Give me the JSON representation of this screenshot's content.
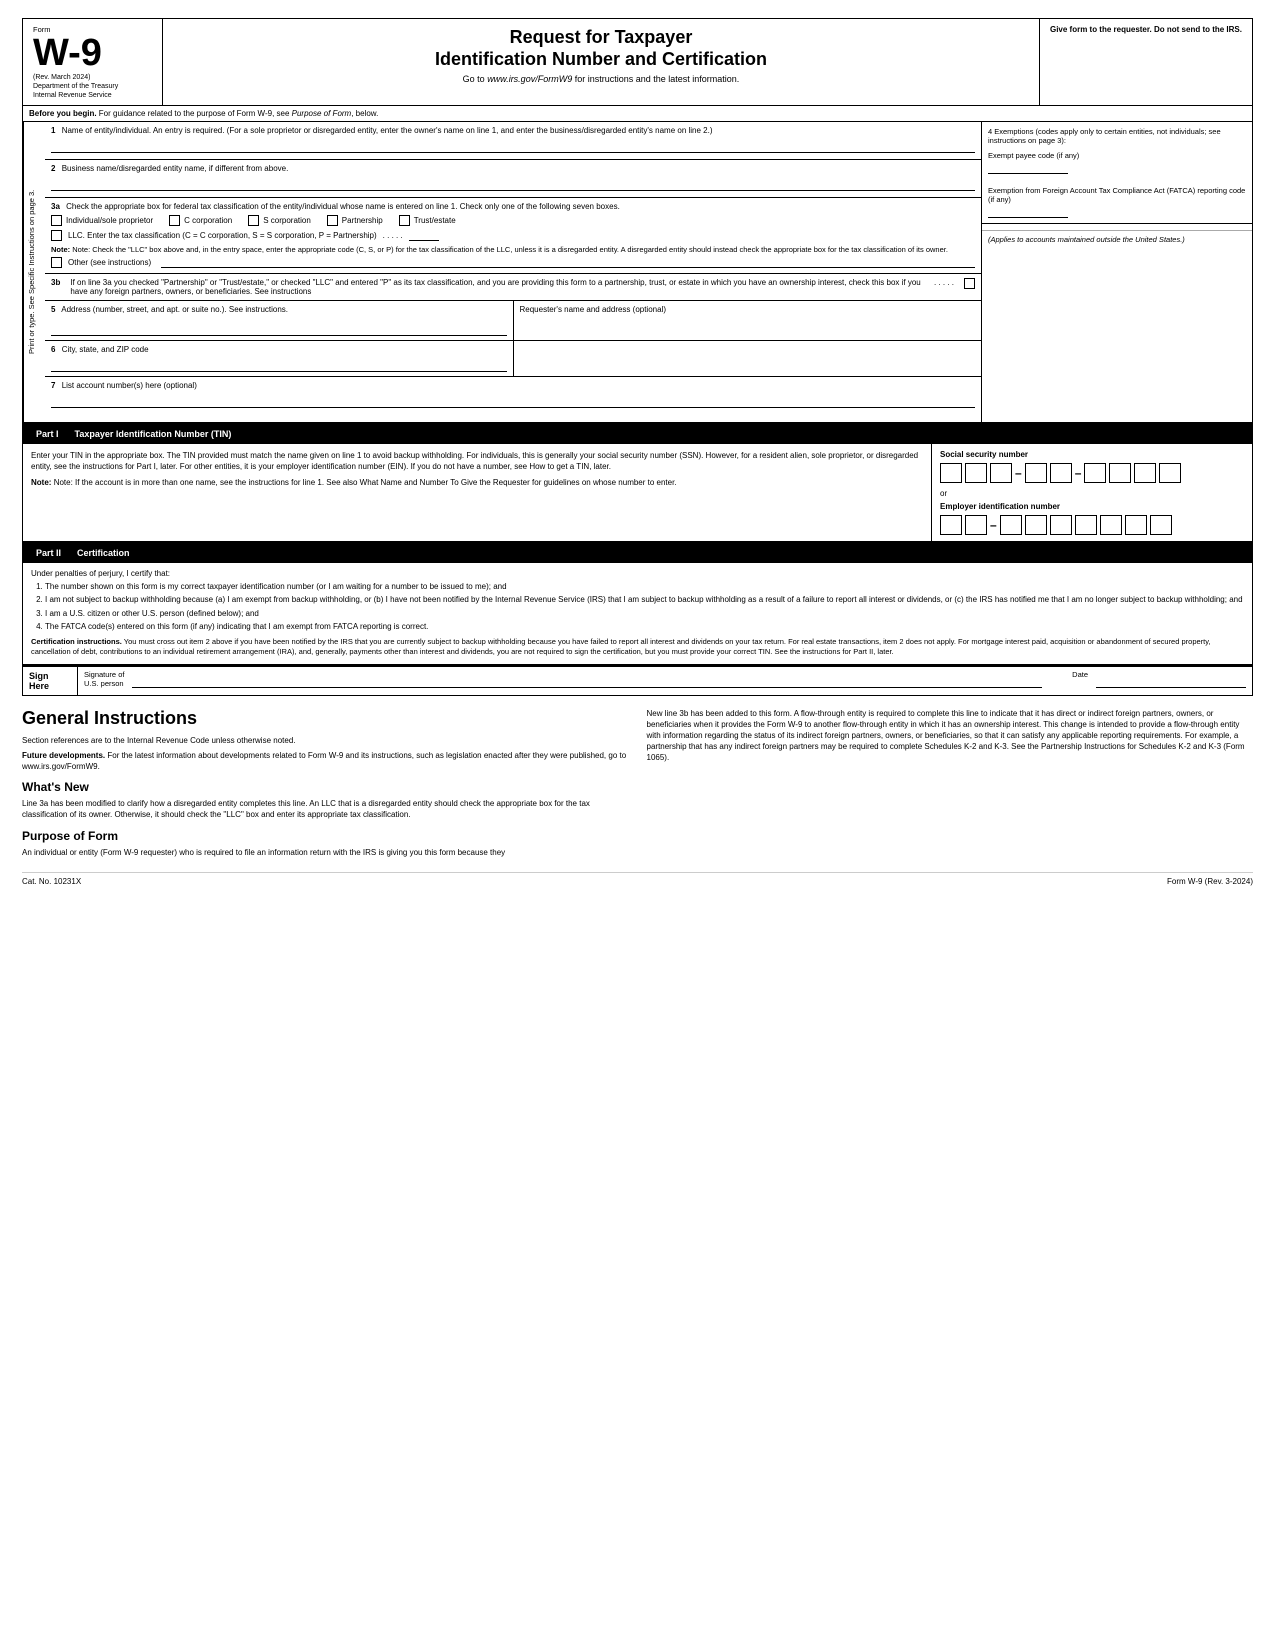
{
  "header": {
    "form_label": "Form",
    "form_number": "W-9",
    "rev_date": "(Rev. March 2024)",
    "dept": "Department of the Treasury",
    "irs": "Internal Revenue Service",
    "title_line1": "Request for Taxpayer",
    "title_line2": "Identification Number and Certification",
    "subtitle": "Go to www.irs.gov/FormW9 for instructions and the latest information.",
    "give_form": "Give form to the requester. Do not send to the IRS."
  },
  "before_begin": {
    "text": "Before you begin. For guidance related to the purpose of Form W-9, see Purpose of Form, below."
  },
  "fields": {
    "field1_label": "1",
    "field1_text": "Name of entity/individual. An entry is required. (For a sole proprietor or disregarded entity, enter the owner's name on line 1, and enter the business/disregarded entity's name on line 2.)",
    "field2_label": "2",
    "field2_text": "Business name/disregarded entity name, if different from above.",
    "field3a_label": "3a",
    "field3a_text": "Check the appropriate box for federal tax classification of the entity/individual whose name is entered on line 1. Check only one of the following seven boxes.",
    "checkboxes": [
      "Individual/sole proprietor",
      "C corporation",
      "S corporation",
      "Partnership",
      "Trust/estate"
    ],
    "llc_text": "LLC. Enter the tax classification (C = C corporation, S = S corporation, P = Partnership)",
    "note_3a": "Note: Check the \"LLC\" box above and, in the entry space, enter the appropriate code (C, S, or P) for the tax classification of the LLC, unless it is a disregarded entity. A disregarded entity should instead check the appropriate box for the tax classification of its owner.",
    "other_text": "Other (see instructions)",
    "field3b_label": "3b",
    "field3b_text": "If on line 3a you checked \"Partnership\" or \"Trust/estate,\" or checked \"LLC\" and entered \"P\" as its tax classification, and you are providing this form to a partnership, trust, or estate in which you have an ownership interest, check this box if you have any foreign partners, owners, or beneficiaries. See instructions",
    "field5_label": "5",
    "field5_text": "Address (number, street, and apt. or suite no.). See instructions.",
    "field5_right": "Requester's name and address (optional)",
    "field6_label": "6",
    "field6_text": "City, state, and ZIP code",
    "field7_label": "7",
    "field7_text": "List account number(s) here (optional)"
  },
  "exemptions": {
    "title": "4 Exemptions (codes apply only to certain entities, not individuals; see instructions on page 3):",
    "exempt_payee": "Exempt payee code (if any)",
    "fatca_title": "Exemption from Foreign Account Tax Compliance Act (FATCA) reporting code (if any)",
    "applies_note": "(Applies to accounts maintained outside the United States.)"
  },
  "part1": {
    "label": "Part I",
    "title": "Taxpayer Identification Number (TIN)",
    "intro": "Enter your TIN in the appropriate box. The TIN provided must match the name given on line 1 to avoid backup withholding. For individuals, this is generally your social security number (SSN). However, for a resident alien, sole proprietor, or disregarded entity, see the instructions for Part I, later. For other entities, it is your employer identification number (EIN). If you do not have a number, see How to get a TIN, later.",
    "note": "Note: If the account is in more than one name, see the instructions for line 1. See also What Name and Number To Give the Requester for guidelines on whose number to enter.",
    "ssn_label": "Social security number",
    "or_text": "or",
    "ein_label": "Employer identification number"
  },
  "part2": {
    "label": "Part II",
    "title": "Certification",
    "under_penalties": "Under penalties of perjury, I certify that:",
    "items": [
      "1. The number shown on this form is my correct taxpayer identification number (or I am waiting for a number to be issued to me); and",
      "2. I am not subject to backup withholding because (a) I am exempt from backup withholding, or (b) I have not been notified by the Internal Revenue Service (IRS) that I am subject to backup withholding as a result of a failure to report all interest or dividends, or (c) the IRS has notified me that I am no longer subject to backup withholding; and",
      "3. I am a U.S. citizen or other U.S. person (defined below); and",
      "4. The FATCA code(s) entered on this form (if any) indicating that I am exempt from FATCA reporting is correct."
    ],
    "cert_instructions_bold": "Certification instructions.",
    "cert_instructions": "You must cross out item 2 above if you have been notified by the IRS that you are currently subject to backup withholding because you have failed to report all interest and dividends on your tax return. For real estate transactions, item 2 does not apply. For mortgage interest paid, acquisition or abandonment of secured property, cancellation of debt, contributions to an individual retirement arrangement (IRA), and, generally, payments other than interest and dividends, you are not required to sign the certification, but you must provide your correct TIN. See the instructions for Part II, later.",
    "sign_here": "Sign Here",
    "sig_of": "Signature of",
    "us_person": "U.S. person",
    "date": "Date"
  },
  "general_instructions": {
    "title": "General Instructions",
    "section_refs": "Section references are to the Internal Revenue Code unless otherwise noted.",
    "future_dev_label": "Future developments.",
    "future_dev": "For the latest information about developments related to Form W-9 and its instructions, such as legislation enacted after they were published, go to www.irs.gov/FormW9.",
    "whats_new_title": "What's New",
    "whats_new_text": "Line 3a has been modified to clarify how a disregarded entity completes this line. An LLC that is a disregarded entity should check the appropriate box for the tax classification of its owner. Otherwise, it should check the \"LLC\" box and enter its appropriate tax classification.",
    "purpose_title": "Purpose of Form",
    "purpose_text": "An individual or entity (Form W-9 requester) who is required to file an information return with the IRS is giving you this form because they",
    "right_col_text": "New line 3b has been added to this form. A flow-through entity is required to complete this line to indicate that it has direct or indirect foreign partners, owners, or beneficiaries when it provides the Form W-9 to another flow-through entity in which it has an ownership interest. This change is intended to provide a flow-through entity with information regarding the status of its indirect foreign partners, owners, or beneficiaries, so that it can satisfy any applicable reporting requirements. For example, a partnership that has any indirect foreign partners may be required to complete Schedules K-2 and K-3. See the Partnership Instructions for Schedules K-2 and K-3 (Form 1065)."
  },
  "footer": {
    "cat_no": "Cat. No. 10231X",
    "form_ref": "Form W-9 (Rev. 3-2024)"
  },
  "side_label": {
    "line1": "Print or type.",
    "line2": "See Specific Instructions on page 3."
  }
}
